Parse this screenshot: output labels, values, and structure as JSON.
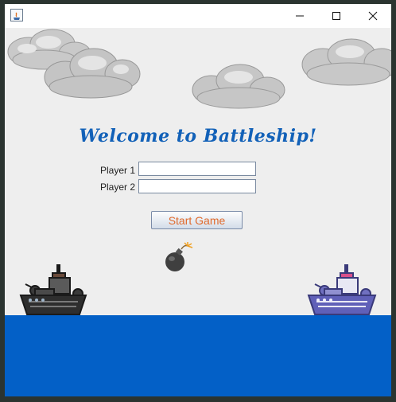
{
  "window": {
    "controls": {
      "minimize": "minimize-icon",
      "maximize": "maximize-icon",
      "close": "close-icon"
    }
  },
  "welcome": {
    "title": "Welcome to Battleship!"
  },
  "form": {
    "player1_label": "Player 1",
    "player1_value": "",
    "player2_label": "Player 2",
    "player2_value": "",
    "start_label": "Start Game"
  },
  "colors": {
    "sea": "#0360c7",
    "title": "#1261b8",
    "button_text": "#e06a2c",
    "background": "#eeeeee"
  },
  "icons": {
    "app": "java-app-icon",
    "bomb": "bomb-icon",
    "ship_left": "battleship-dark-icon",
    "ship_right": "battleship-purple-icon",
    "cloud": "cloud-icon"
  }
}
